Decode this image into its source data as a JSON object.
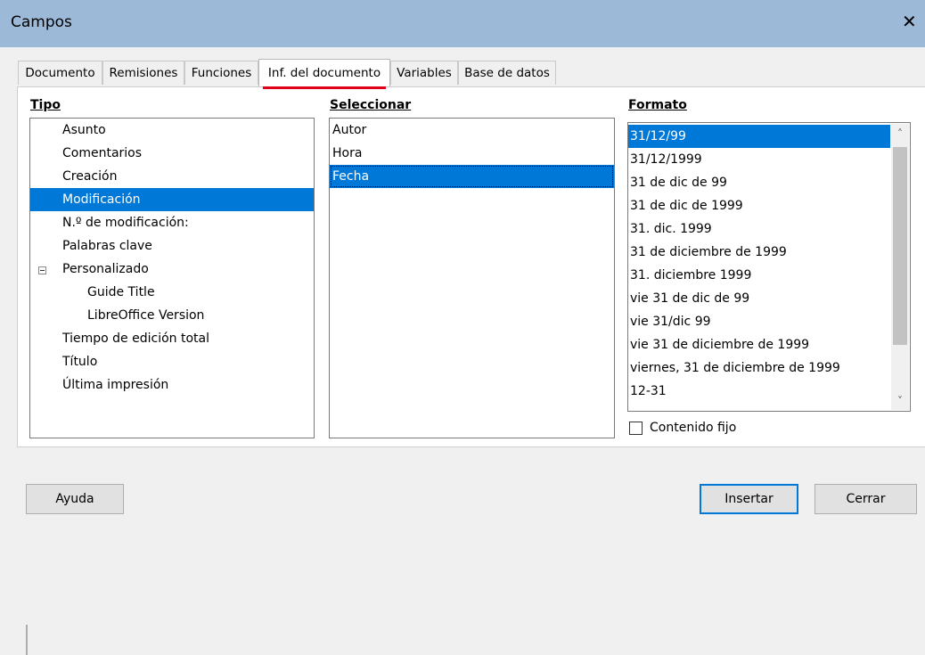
{
  "window": {
    "title": "Campos",
    "close_glyph": "✕"
  },
  "tabs": [
    {
      "label": "Documento"
    },
    {
      "label": "Remisiones"
    },
    {
      "label": "Funciones"
    },
    {
      "label": "Inf. del documento",
      "active": true
    },
    {
      "label": "Variables"
    },
    {
      "label": "Base de datos"
    }
  ],
  "tipo": {
    "header": "Tipo",
    "items": [
      {
        "label": "Asunto"
      },
      {
        "label": "Comentarios"
      },
      {
        "label": "Creación"
      },
      {
        "label": "Modificación",
        "selected": true
      },
      {
        "label": "N.º de modificación:"
      },
      {
        "label": "Palabras clave"
      },
      {
        "label": "Personalizado",
        "expanded": true
      },
      {
        "label": "Guide Title",
        "child": true
      },
      {
        "label": "LibreOffice Version",
        "child": true
      },
      {
        "label": "Tiempo de edición total"
      },
      {
        "label": "Título"
      },
      {
        "label": "Última impresión"
      }
    ]
  },
  "seleccionar": {
    "header": "Seleccionar",
    "items": [
      {
        "label": "Autor"
      },
      {
        "label": "Hora"
      },
      {
        "label": "Fecha",
        "selected": true
      }
    ]
  },
  "formato": {
    "header": "Formato",
    "items": [
      {
        "label": "31/12/99",
        "selected": true
      },
      {
        "label": "31/12/1999"
      },
      {
        "label": "31 de dic de 99"
      },
      {
        "label": "31 de dic de 1999"
      },
      {
        "label": "31. dic. 1999"
      },
      {
        "label": "31 de diciembre de 1999"
      },
      {
        "label": "31. diciembre 1999"
      },
      {
        "label": "vie 31 de dic de 99"
      },
      {
        "label": "vie 31/dic 99"
      },
      {
        "label": "vie 31 de diciembre de 1999"
      },
      {
        "label": "viernes, 31 de diciembre de 1999"
      },
      {
        "label": "12-31"
      }
    ],
    "scroll_up": "˄",
    "scroll_down": "˅"
  },
  "contenido_fijo": {
    "label": "Contenido fijo",
    "checked": false
  },
  "buttons": {
    "help": "Ayuda",
    "insert": "Insertar",
    "close": "Cerrar"
  },
  "colors": {
    "selection": "#0078d7",
    "titlebar": "#9db9d8",
    "tab_indicator": "#e3001b"
  }
}
